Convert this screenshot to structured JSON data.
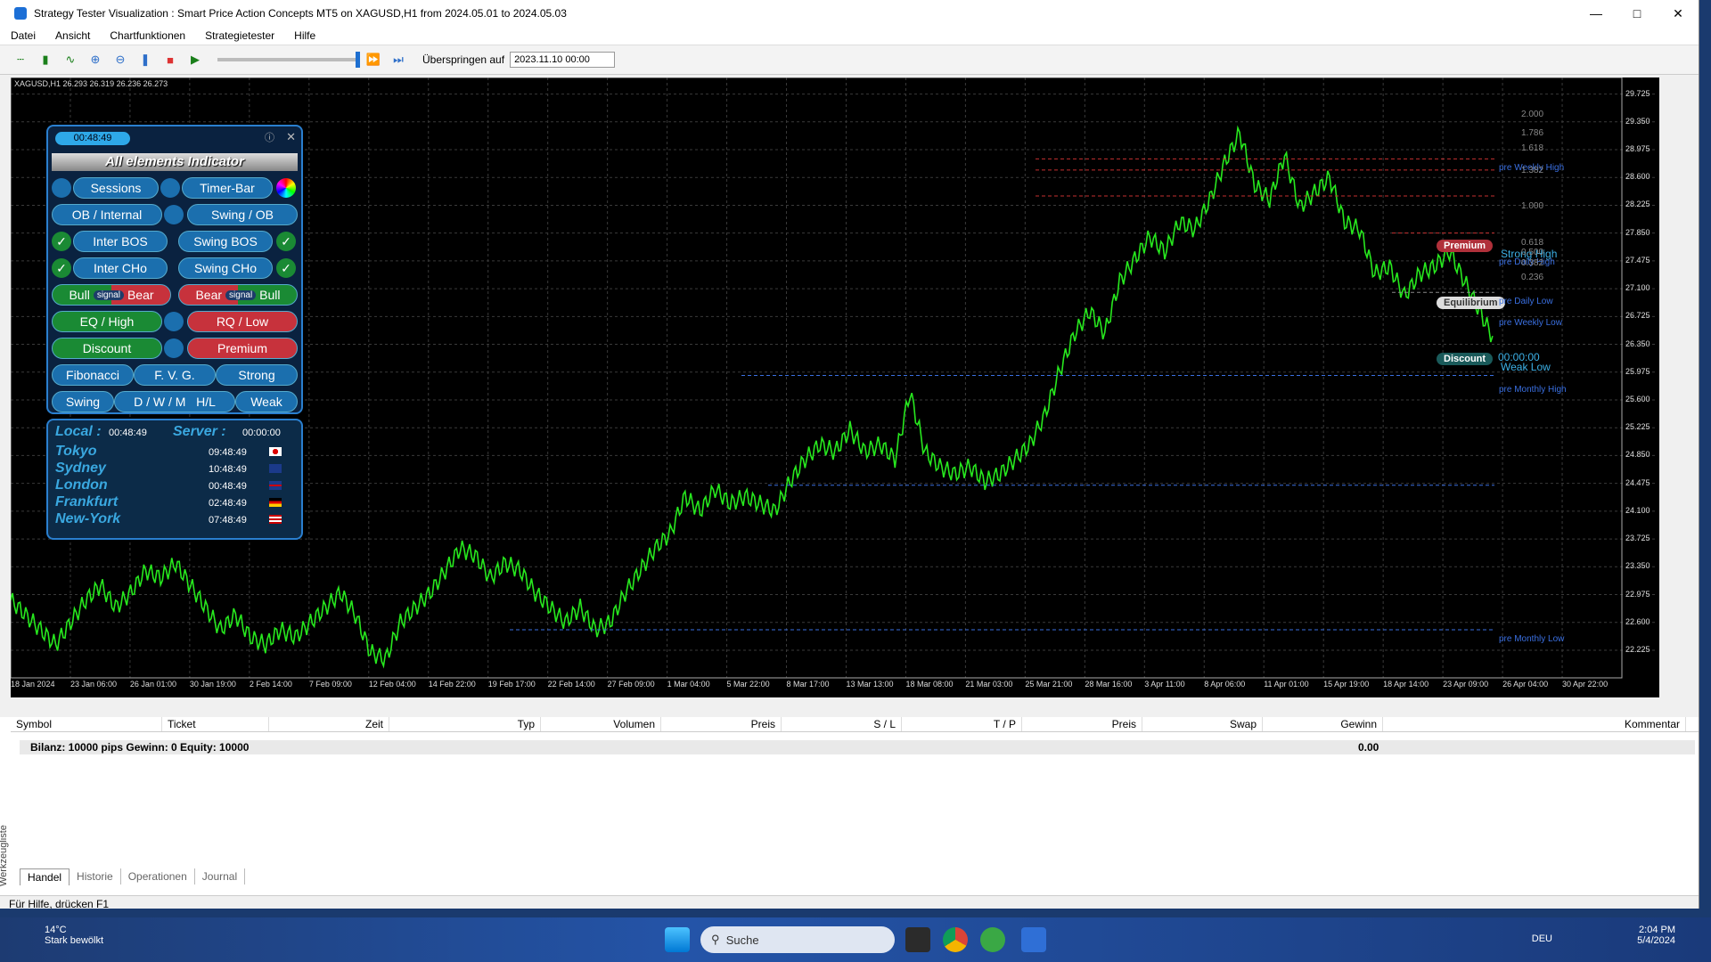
{
  "window": {
    "title": "Strategy Tester Visualization : Smart Price Action Concepts MT5 on XAGUSD,H1 from 2024.05.01 to 2024.05.03"
  },
  "menu": [
    "Datei",
    "Ansicht",
    "Chartfunktionen",
    "Strategietester",
    "Hilfe"
  ],
  "toolbar": {
    "skip_label": "Überspringen auf",
    "date_value": "2023.11.10 00:00"
  },
  "chart": {
    "symbol_line": "XAGUSD,H1  26.293 26.319 26.236 26.273",
    "y_ticks": [
      "29.725",
      "29.350",
      "28.975",
      "28.600",
      "28.225",
      "27.850",
      "27.475",
      "27.100",
      "26.725",
      "26.350",
      "25.975",
      "25.600",
      "25.225",
      "24.850",
      "24.475",
      "24.100",
      "23.725",
      "23.350",
      "22.975",
      "22.600",
      "22.225"
    ],
    "x_ticks": [
      "18 Jan 2024",
      "23 Jan 06:00",
      "26 Jan 01:00",
      "30 Jan 19:00",
      "2 Feb 14:00",
      "7 Feb 09:00",
      "12 Feb 04:00",
      "14 Feb 22:00",
      "19 Feb 17:00",
      "22 Feb 14:00",
      "27 Feb 09:00",
      "1 Mar 04:00",
      "5 Mar 22:00",
      "8 Mar 17:00",
      "13 Mar 13:00",
      "18 Mar 08:00",
      "21 Mar 03:00",
      "25 Mar 21:00",
      "28 Mar 16:00",
      "3 Apr 11:00",
      "8 Apr 06:00",
      "11 Apr 01:00",
      "15 Apr 19:00",
      "18 Apr 14:00",
      "23 Apr 09:00",
      "26 Apr 04:00",
      "30 Apr 22:00"
    ],
    "fib_levels": [
      "2.000",
      "1.786",
      "1.618",
      "1.382",
      "1.000",
      "0.618",
      "0.500",
      "0.382",
      "0.236"
    ],
    "labels": {
      "premium": "Premium",
      "equilibrium": "Equilibrium",
      "discount": "Discount",
      "strong_high": "Strong High",
      "weak_low": "Weak Low",
      "pre_weekly_high": "pre Weekly High",
      "pre_daily_high": "pre Daily High",
      "pre_daily_low": "pre Daily Low",
      "pre_weekly_low": "pre Weekly Low",
      "pre_monthly_high": "pre Monthly High",
      "pre_monthly_low": "pre Monthly Low",
      "timer": "00:00:00"
    }
  },
  "panel": {
    "clock": "00:48:49",
    "header": "All  elements  Indicator",
    "sessions": "Sessions",
    "timer_bar": "Timer-Bar",
    "ob_internal": "OB / Internal",
    "swing_ob": "Swing / OB",
    "inter_bos": "Inter BOS",
    "swing_bos": "Swing BOS",
    "inter_cho": "Inter CHo",
    "swing_cho": "Swing CHo",
    "bull": "Bull",
    "signal": "signal",
    "bear": "Bear",
    "bear2": "Bear",
    "bull2": "Bull",
    "eq_high": "EQ / High",
    "rq_low": "RQ / Low",
    "discount": "Discount",
    "premium": "Premium",
    "fibonacci": "Fibonacci",
    "fvg": "F. V. G.",
    "strong": "Strong",
    "swing": "Swing",
    "dwm": "D / W / M",
    "hl": "H/L",
    "weak": "Weak"
  },
  "world": {
    "local_label": "Local :",
    "local_time": "00:48:49",
    "server_label": "Server :",
    "server_time": "00:00:00",
    "cities": [
      {
        "name": "Tokyo",
        "time": "09:48:49"
      },
      {
        "name": "Sydney",
        "time": "10:48:49"
      },
      {
        "name": "London",
        "time": "00:48:49"
      },
      {
        "name": "Frankfurt",
        "time": "02:48:49"
      },
      {
        "name": "New-York",
        "time": "07:48:49"
      }
    ]
  },
  "terminal": {
    "columns": [
      "Symbol",
      "Ticket",
      "Zeit",
      "Typ",
      "Volumen",
      "Preis",
      "S / L",
      "T / P",
      "Preis",
      "Swap",
      "Gewinn",
      "Kommentar"
    ],
    "balance_row": "Bilanz: 10000 pips   Gewinn: 0   Equity: 10000",
    "profit": "0.00",
    "tabs": [
      "Handel",
      "Historie",
      "Operationen",
      "Journal"
    ],
    "side_label": "Werkzeugliste"
  },
  "status": "Für Hilfe, drücken F1",
  "taskbar": {
    "temp": "14°C",
    "weather": "Stark bewölkt",
    "search": "Suche",
    "lang": "DEU",
    "time": "2:04 PM",
    "date": "5/4/2024"
  },
  "price_series": [
    22.9,
    22.7,
    22.5,
    22.3,
    22.6,
    22.9,
    23.1,
    22.8,
    23.0,
    23.3,
    23.2,
    23.4,
    23.1,
    22.8,
    22.5,
    22.7,
    22.4,
    22.3,
    22.5,
    22.4,
    22.6,
    22.8,
    23.0,
    22.7,
    22.2,
    22.1,
    22.6,
    22.8,
    23.0,
    23.3,
    23.6,
    23.5,
    23.2,
    23.4,
    23.3,
    23.0,
    22.8,
    22.6,
    22.8,
    22.5,
    22.6,
    23.0,
    23.3,
    23.6,
    23.8,
    24.3,
    24.1,
    24.4,
    24.2,
    24.3,
    24.2,
    24.1,
    24.5,
    24.8,
    25.0,
    24.9,
    25.2,
    24.9,
    25.0,
    24.8,
    25.7,
    24.9,
    24.7,
    24.6,
    24.7,
    24.5,
    24.6,
    24.8,
    25.0,
    25.4,
    26.0,
    26.5,
    26.8,
    26.5,
    27.2,
    27.5,
    27.8,
    27.6,
    28.0,
    27.9,
    28.3,
    28.8,
    29.2,
    28.5,
    28.3,
    28.9,
    28.2,
    28.4,
    28.6,
    28.0,
    27.9,
    27.3,
    27.4,
    27.0,
    27.3,
    27.4,
    27.6,
    27.2,
    26.8,
    26.4
  ]
}
